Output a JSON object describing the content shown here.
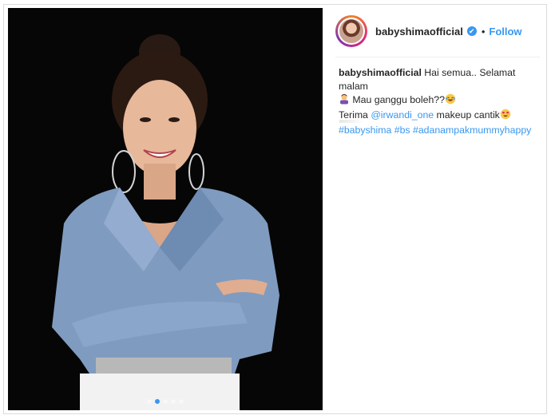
{
  "post": {
    "username": "babyshimaofficial",
    "bullet": "•",
    "follow_label": "Follow",
    "verified_icon": "✔",
    "colors": {
      "accent": "#3897f0",
      "text": "#262626",
      "border": "#dbdbdb"
    }
  },
  "caption": {
    "username": "babyshimaofficial",
    "line1": " Hai semua.. Selamat malam",
    "line2": " Mau ganggu boleh??",
    "line3_prefix": "Terima ",
    "mention": "@irwandi_one",
    "line3_suffix": " makeup cantik",
    "hashtags": [
      "#babyshima",
      "#bs",
      "#adanampakmummyhappy"
    ]
  },
  "carousel": {
    "count": 5,
    "active": 1
  }
}
